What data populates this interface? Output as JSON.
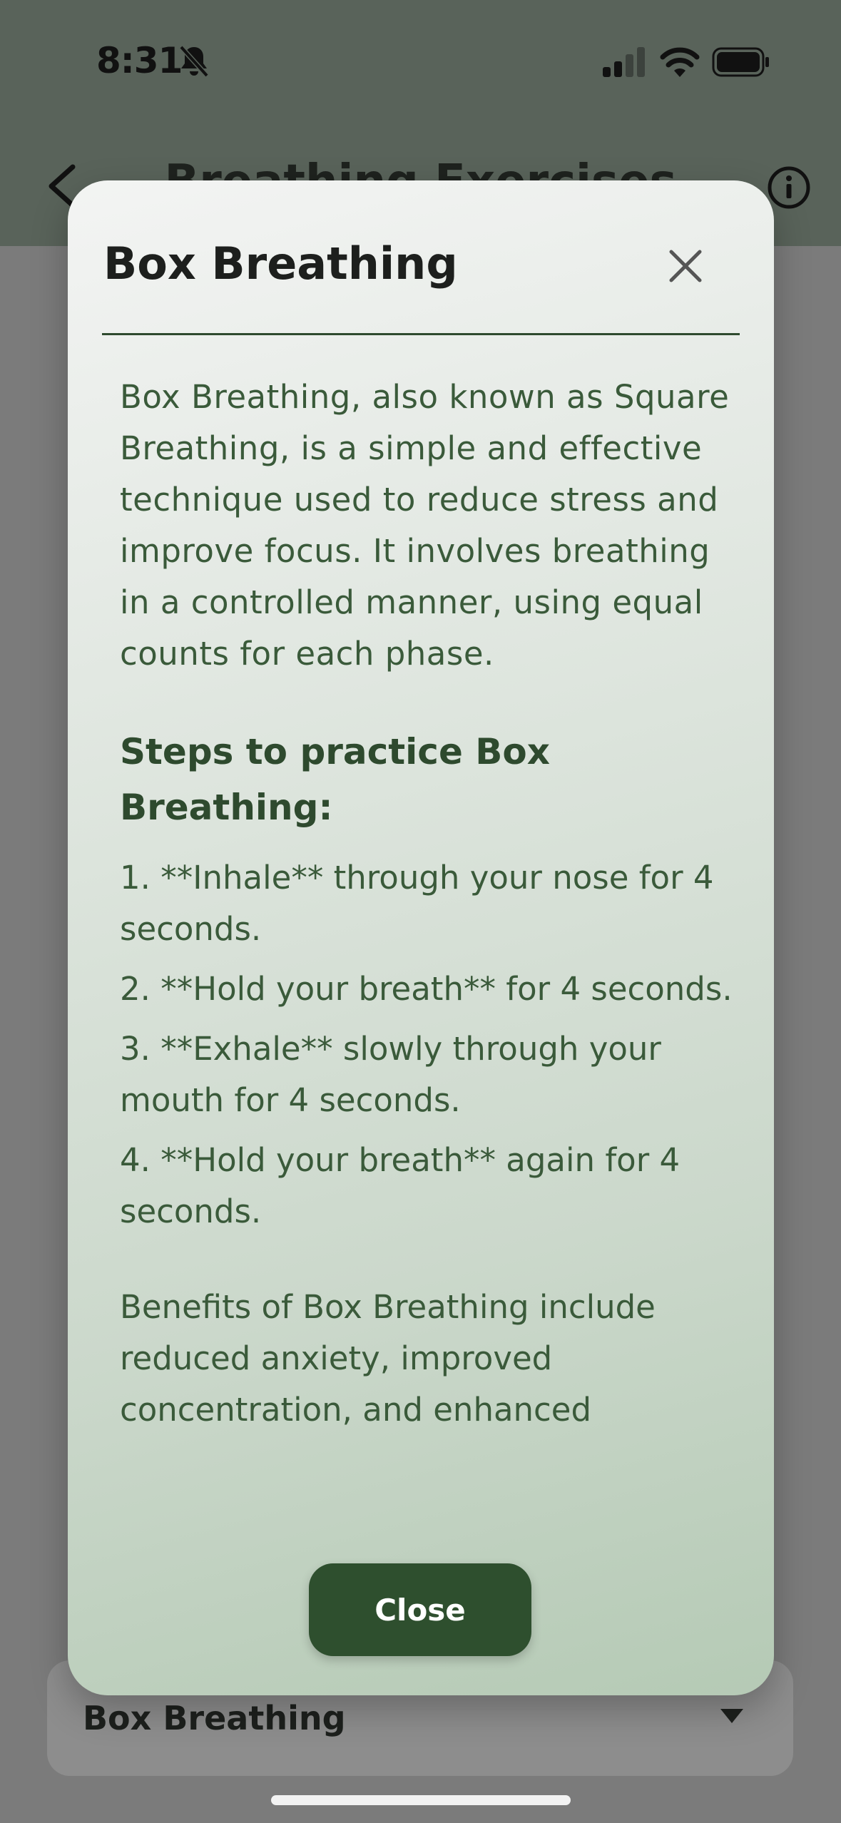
{
  "status_bar": {
    "time": "8:31"
  },
  "header": {
    "title": "Breathing Exercises"
  },
  "selector": {
    "value": "Box Breathing"
  },
  "modal": {
    "title": "Box Breathing",
    "intro": "Box Breathing, also known as Square Breathing, is a simple and effective technique used to reduce stress and improve focus. It involves breathing in a controlled manner, using equal counts for each phase.",
    "steps_heading": "Steps to practice Box Breathing:",
    "steps": [
      "1. **Inhale** through your nose for 4 seconds.",
      "2. **Hold your breath** for 4 seconds.",
      "3. **Exhale** slowly through your mouth for 4 seconds.",
      "4. **Hold your breath** again for 4 seconds."
    ],
    "benefits": "Benefits of Box Breathing include reduced anxiety, improved concentration, and enhanced",
    "close_label": "Close"
  },
  "icons": {
    "muted": "bell-slash-icon",
    "signal": "cellular-signal-icon",
    "wifi": "wifi-icon",
    "battery": "battery-icon",
    "back": "chevron-left-icon",
    "info": "info-circle-icon",
    "close": "close-icon",
    "dropdown": "caret-down-icon"
  },
  "colors": {
    "primary_green": "#2e4f2e",
    "text_green": "#3a5a3a",
    "header_bg": "#59635a"
  }
}
